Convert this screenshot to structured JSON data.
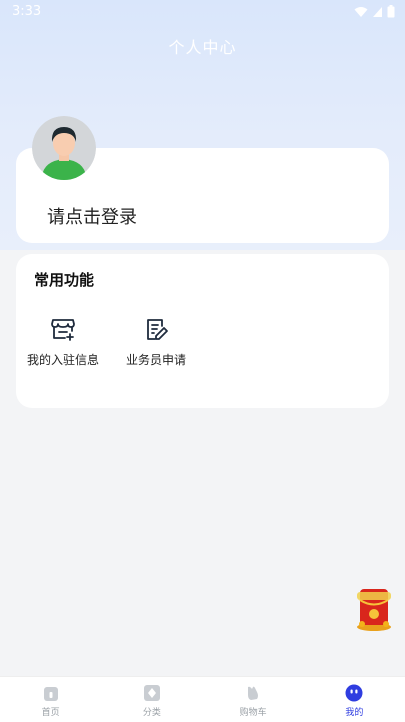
{
  "status": {
    "time": "3:33"
  },
  "header": {
    "title": "个人中心"
  },
  "login": {
    "prompt": "请点击登录"
  },
  "functions": {
    "title": "常用功能",
    "items": [
      {
        "label": "我的入驻信息",
        "icon": "storefront-add-icon"
      },
      {
        "label": "业务员申请",
        "icon": "edit-document-icon"
      }
    ]
  },
  "tabbar": {
    "items": [
      {
        "label": "首页",
        "icon": "home-icon"
      },
      {
        "label": "分类",
        "icon": "category-icon"
      },
      {
        "label": "购物车",
        "icon": "cart-icon"
      },
      {
        "label": "我的",
        "icon": "profile-icon"
      }
    ],
    "active_index": 3,
    "active_color": "#2f3de0"
  },
  "promo": {
    "icon": "red-envelope-promo-icon"
  }
}
